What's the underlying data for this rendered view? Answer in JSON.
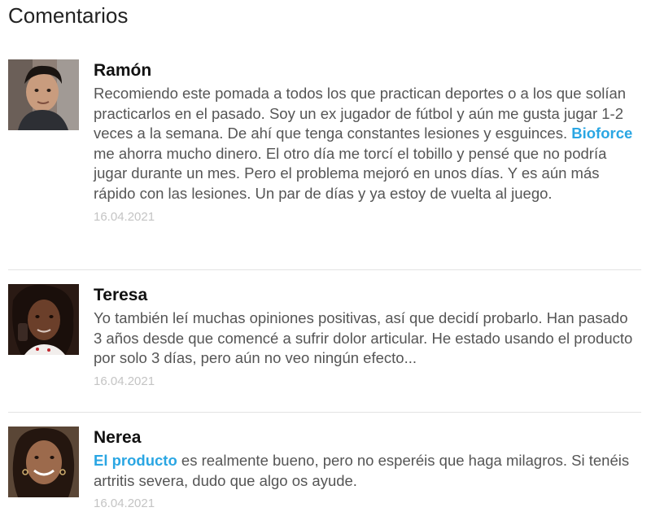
{
  "section": {
    "title": "Comentarios"
  },
  "comments": [
    {
      "name": "Ramón",
      "text_before": "Recomiendo este pomada a todos los que practican deportes o a los que solían practicarlos en el pasado. Soy un ex jugador de fútbol y aún me gusta jugar 1-2 veces a la semana. De ahí que tenga constantes lesiones y esguinces. ",
      "highlight": "Bioforce",
      "text_after": " me ahorra mucho dinero. El otro día me torcí el tobillo y pensé que no podría jugar durante un mes. Pero el problema mejoró en unos días. Y es aún más rápido con las lesiones. Un par de días y ya estoy de vuelta al juego.",
      "date": "16.04.2021"
    },
    {
      "name": "Teresa",
      "text_before": "Yo también leí muchas opiniones positivas, así que decidí probarlo. Han pasado 3 años desde que comencé a sufrir dolor articular. He estado usando el producto por solo 3 días, pero aún no veo ningún efecto...",
      "highlight": "",
      "text_after": "",
      "date": "16.04.2021"
    },
    {
      "name": "Nerea",
      "text_before": "",
      "highlight": "El producto",
      "text_after": " es realmente bueno, pero no esperéis que haga milagros. Si tenéis artritis severa, dudo que algo os ayude.",
      "date": "16.04.2021"
    }
  ],
  "colors": {
    "accent": "#2aa6e3",
    "text": "#555555",
    "name": "#111111",
    "date": "#c4c4c4",
    "divider": "#e3e3e3"
  },
  "icons": {
    "avatar": "user-photo"
  }
}
